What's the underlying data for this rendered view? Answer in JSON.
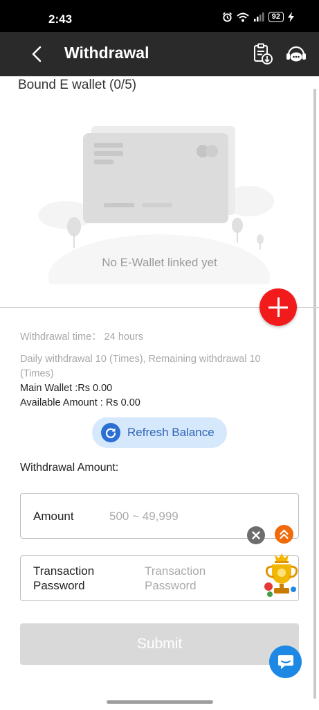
{
  "status_bar": {
    "time": "2:43",
    "battery": "92"
  },
  "header": {
    "title": "Withdrawal",
    "icons": [
      "back-arrow-icon",
      "withdrawal-record-icon",
      "customer-service-icon"
    ]
  },
  "wallet_section": {
    "title": "Bound E wallet (0/5)",
    "empty_text": "No E-Wallet linked yet"
  },
  "info": {
    "withdrawal_time": "Withdrawal time：  24 hours",
    "daily_withdrawal": "Daily withdrawal 10 (Times), Remaining withdrawal 10 (Times)",
    "main_wallet": "Main Wallet :Rs 0.00",
    "available_amount": "Available Amount : Rs 0.00"
  },
  "refresh_label": "Refresh Balance",
  "amount_section": {
    "title": "Withdrawal Amount:"
  },
  "form": {
    "amount_label": "Amount",
    "amount_placeholder": "500 ~ 49,999",
    "password_label": "Transaction\nPassword",
    "password_placeholder": "Transaction\nPassword"
  },
  "submit_label": "Submit",
  "colors": {
    "header_bg": "#2a2a2a",
    "add_button": "#f21b1b",
    "refresh_bg": "#d6e8fb",
    "refresh_text": "#2f63b8",
    "submit_disabled": "#d9d9d9",
    "chat_button": "#1e88e5",
    "scroll_top_button": "#f16a0c"
  }
}
